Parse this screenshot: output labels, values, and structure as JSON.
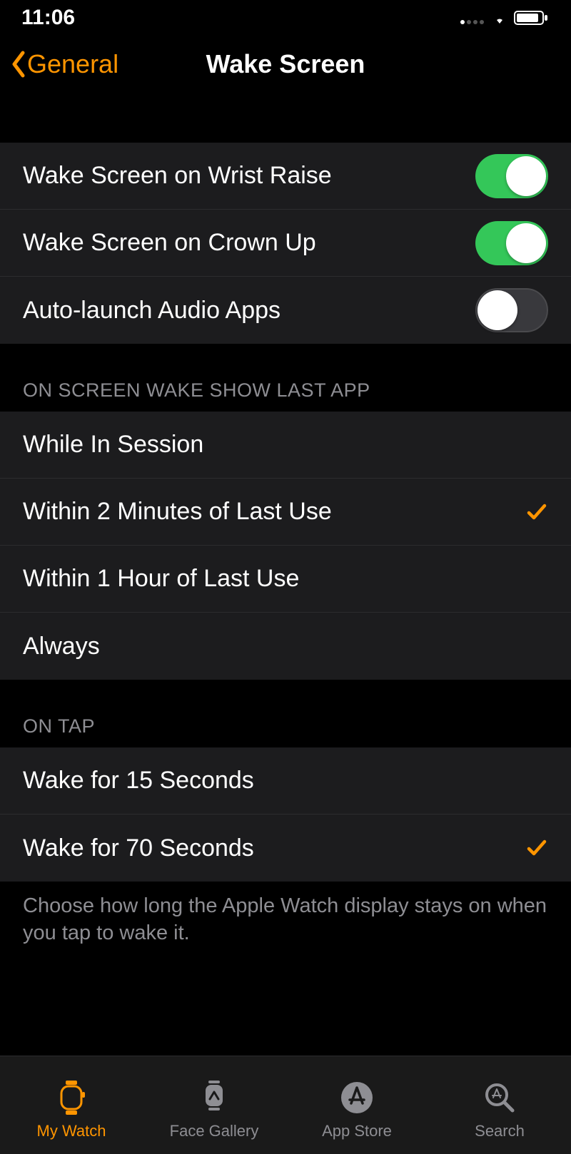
{
  "statusBar": {
    "time": "11:06"
  },
  "nav": {
    "back": "General",
    "title": "Wake Screen"
  },
  "toggles": [
    {
      "label": "Wake Screen on Wrist Raise",
      "on": true
    },
    {
      "label": "Wake Screen on Crown Up",
      "on": true
    },
    {
      "label": "Auto-launch Audio Apps",
      "on": false
    }
  ],
  "lastAppHeader": "ON SCREEN WAKE SHOW LAST APP",
  "lastAppOptions": [
    {
      "label": "While In Session",
      "selected": false
    },
    {
      "label": "Within 2 Minutes of Last Use",
      "selected": true
    },
    {
      "label": "Within 1 Hour of Last Use",
      "selected": false
    },
    {
      "label": "Always",
      "selected": false
    }
  ],
  "onTapHeader": "ON TAP",
  "onTapOptions": [
    {
      "label": "Wake for 15 Seconds",
      "selected": false
    },
    {
      "label": "Wake for 70 Seconds",
      "selected": true
    }
  ],
  "onTapFooter": "Choose how long the Apple Watch display stays on when you tap to wake it.",
  "tabs": [
    {
      "label": "My Watch",
      "active": true
    },
    {
      "label": "Face Gallery",
      "active": false
    },
    {
      "label": "App Store",
      "active": false
    },
    {
      "label": "Search",
      "active": false
    }
  ]
}
